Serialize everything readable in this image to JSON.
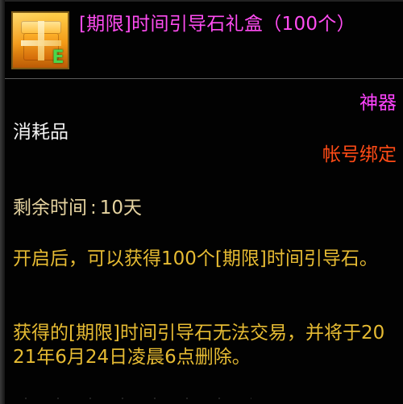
{
  "item": {
    "name": "[期限]时间引导石礼盒（100个）",
    "grade": "神器",
    "binding": "帐号绑定",
    "category": "消耗品",
    "icon": "gift-box-icon",
    "icon_badge": "E"
  },
  "time": {
    "label": "剩余时间",
    "separator": ":",
    "value": "10天"
  },
  "description": {
    "line_1": "开启后，可以获得100个[期限]时间引导石。",
    "line_2": "获得的[期限]时间引导石无法交易，并将于2021年6月24日凌晨6点删除。"
  },
  "colors": {
    "title": "#ff4cf1",
    "grade": "#ff43ff",
    "binding": "#ff4b16",
    "category": "#f2f2f2",
    "time": "#e5d3a0",
    "description": "#e6bb33"
  }
}
